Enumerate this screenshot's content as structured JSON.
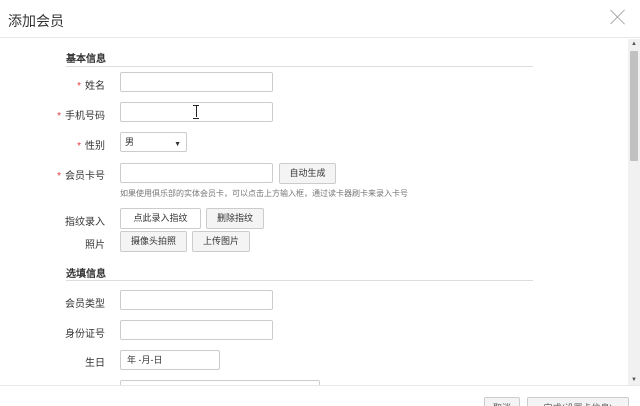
{
  "dialog": {
    "title": "添加会员"
  },
  "sections": {
    "basic": "基本信息",
    "optional": "选填信息"
  },
  "fields": {
    "name": {
      "required": "*",
      "label": "姓名",
      "value": ""
    },
    "phone": {
      "required": "*",
      "label": "手机号码",
      "value": ""
    },
    "gender": {
      "required": "*",
      "label": "性别",
      "value": "男"
    },
    "card": {
      "required": "*",
      "label": "会员卡号",
      "value": "",
      "auto_btn": "自动生成",
      "hint": "如果使用俱乐部的实体会员卡，可以点击上方输入框，通过读卡器刷卡来录入卡号"
    },
    "fingerprint": {
      "label": "指纹录入",
      "record_btn": "点此录入指纹",
      "delete_btn": "删除指纹"
    },
    "photo": {
      "label": "照片",
      "camera_btn": "摄像头拍照",
      "upload_btn": "上传图片"
    },
    "member_type": {
      "label": "会员类型",
      "value": ""
    },
    "id_number": {
      "label": "身份证号",
      "value": ""
    },
    "birthday": {
      "label": "生日",
      "value": "年 -月-日"
    }
  },
  "footer": {
    "cancel": "取消",
    "save_card": "完成(设置卡信息)"
  }
}
